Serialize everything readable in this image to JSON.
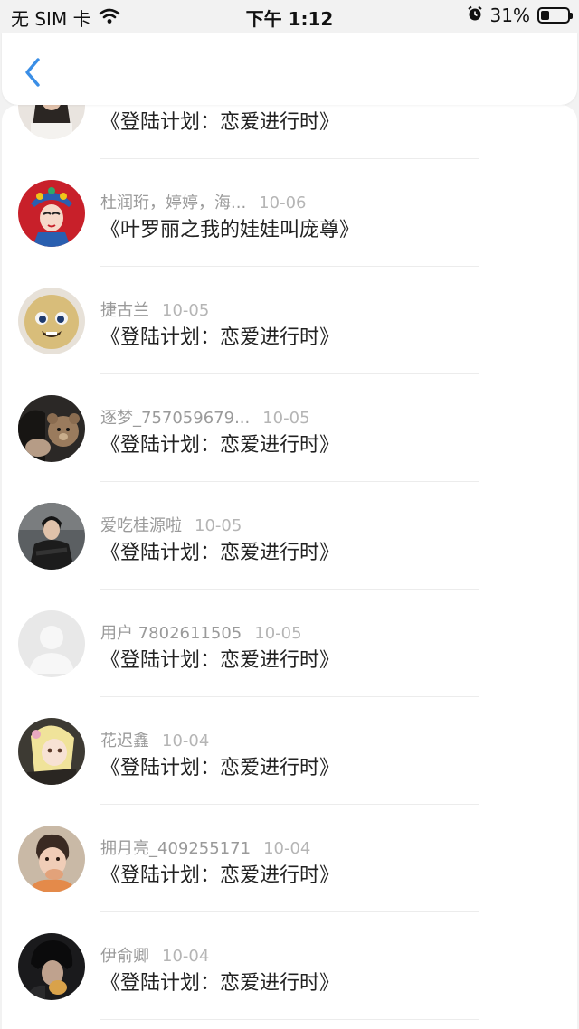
{
  "status_bar": {
    "carrier": "无 SIM 卡",
    "time": "下午 1:12",
    "battery_percent": "31%",
    "battery_level": 0.31
  },
  "nav": {
    "back_icon": "chevron-left-icon",
    "accent_color": "#3a8ee6"
  },
  "items": [
    {
      "name": "",
      "date": "",
      "title": "《登陆计划：恋爱进行时》",
      "avatar": "photo-girl"
    },
    {
      "name": "杜润珩，婷婷，海...",
      "date": "10-06",
      "title": "《叶罗丽之我的娃娃叫庞尊》",
      "avatar": "opera-mask"
    },
    {
      "name": "捷古兰",
      "date": "10-05",
      "title": "《登陆计划：恋爱进行时》",
      "avatar": "plush-toy"
    },
    {
      "name": "逐梦_757059679...",
      "date": "10-05",
      "title": "《登陆计划：恋爱进行时》",
      "avatar": "teddy-bear"
    },
    {
      "name": "爱吃桂源啦",
      "date": "10-05",
      "title": "《登陆计划：恋爱进行时》",
      "avatar": "photo-boy"
    },
    {
      "name": "用户 7802611505",
      "date": "10-05",
      "title": "《登陆计划：恋爱进行时》",
      "avatar": "default-user"
    },
    {
      "name": "花迟鑫",
      "date": "10-04",
      "title": "《登陆计划：恋爱进行时》",
      "avatar": "anime-character"
    },
    {
      "name": "拥月亮_409255171",
      "date": "10-04",
      "title": "《登陆计划：恋爱进行时》",
      "avatar": "photo-child"
    },
    {
      "name": "伊俞卿",
      "date": "10-04",
      "title": "《登陆计划：恋爱进行时》",
      "avatar": "photo-dark"
    }
  ]
}
